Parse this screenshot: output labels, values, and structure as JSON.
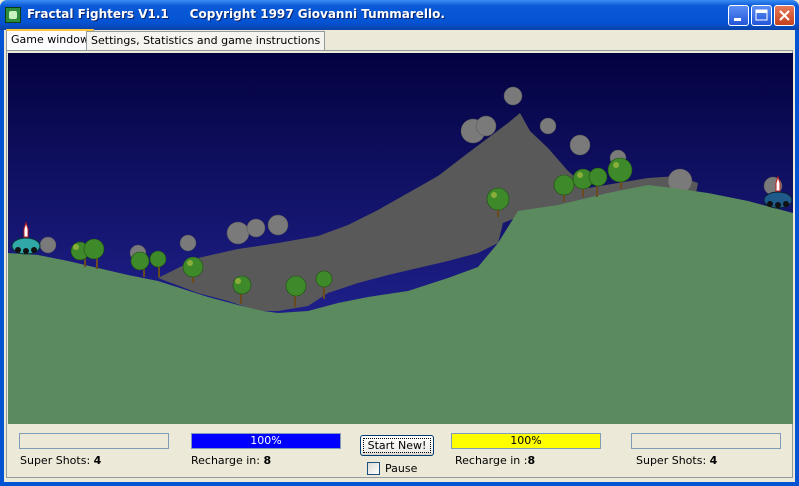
{
  "window": {
    "title": "Fractal Fighters V1.1     Copyright 1997 Giovanni Tummarello.",
    "minimize": "minimize",
    "maximize": "maximize",
    "close": "close"
  },
  "tabs": [
    {
      "label": "Game window",
      "selected": true
    },
    {
      "label": "Settings, Statistics and game instructions",
      "selected": false
    }
  ],
  "game": {
    "sky_color_top": "#030240",
    "sky_color_bottom": "#2A2CA8",
    "ground_color": "#5B8A5E",
    "mountain_color": "#595959",
    "player_left": {
      "color": "#30A8A8",
      "icon": "tank-icon"
    },
    "player_right": {
      "color": "#1E5A8A",
      "icon": "tank-icon"
    }
  },
  "hud": {
    "left_player": {
      "super_shots_label": "Super Shots:",
      "super_shots_value": "4",
      "super_shots_progress": 0,
      "recharge_label": "Recharge in:",
      "recharge_value": "8",
      "power_text": "100%",
      "power_percent": 100,
      "power_color": "#0000FF"
    },
    "right_player": {
      "super_shots_label": "Super Shots:",
      "super_shots_value": "4",
      "super_shots_progress": 0,
      "recharge_label": "Recharge in :",
      "recharge_value": "8",
      "power_text": "100%",
      "power_percent": 100,
      "power_color": "#FFFF00"
    },
    "start_button": "Start New!",
    "pause_label": "Pause",
    "pause_checked": false
  }
}
